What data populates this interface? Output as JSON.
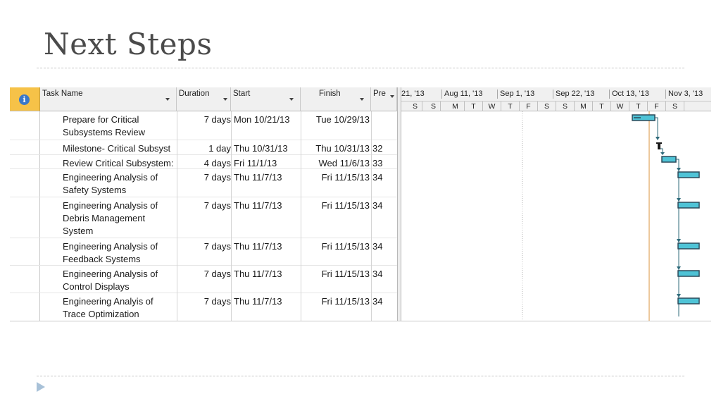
{
  "slide": {
    "title": "Next Steps"
  },
  "columns": {
    "task_name": "Task Name",
    "duration": "Duration",
    "start": "Start",
    "finish": "Finish",
    "predecessors": "Pre"
  },
  "tasks": [
    {
      "name": "Prepare for Critical Subsystems Review",
      "duration": "7 days",
      "start": "Mon 10/21/13",
      "finish": "Tue 10/29/13",
      "pre": ""
    },
    {
      "name": "Milestone- Critical Subsyst",
      "duration": "1 day",
      "start": "Thu 10/31/13",
      "finish": "Thu 10/31/13",
      "pre": "32"
    },
    {
      "name": "Review Critical Subsystem:",
      "duration": "4 days",
      "start": "Fri 11/1/13",
      "finish": "Wed 11/6/13",
      "pre": "33"
    },
    {
      "name": "Engineering Analysis of Safety Systems",
      "duration": "7 days",
      "start": "Thu 11/7/13",
      "finish": "Fri 11/15/13",
      "pre": "34"
    },
    {
      "name": "Engineering Analysis of Debris Management System",
      "duration": "7 days",
      "start": "Thu 11/7/13",
      "finish": "Fri 11/15/13",
      "pre": "34"
    },
    {
      "name": "Engineering Analysis of Feedback Systems",
      "duration": "7 days",
      "start": "Thu 11/7/13",
      "finish": "Fri 11/15/13",
      "pre": "34"
    },
    {
      "name": "Engineering Analysis of Control Displays",
      "duration": "7 days",
      "start": "Thu 11/7/13",
      "finish": "Fri 11/15/13",
      "pre": "34"
    },
    {
      "name": "Engineering Analyis of Trace Optimization",
      "duration": "7 days",
      "start": "Thu 11/7/13",
      "finish": "Fri 11/15/13",
      "pre": "34"
    }
  ],
  "timescale": {
    "major": [
      "21, '13",
      "Aug 11, '13",
      "Sep 1, '13",
      "Sep 22, '13",
      "Oct 13, '13",
      "Nov 3, '13"
    ],
    "minor": [
      "S",
      "S",
      "M",
      "T",
      "W",
      "T",
      "F",
      "S",
      "S",
      "M",
      "T",
      "W",
      "T",
      "F",
      "S"
    ]
  },
  "colors": {
    "bar_fill": "#4fc3d6",
    "bar_border": "#2b4a5a",
    "today_line": "#e0a35a",
    "link": "#2e6a7a",
    "info_header": "#f6c248"
  }
}
